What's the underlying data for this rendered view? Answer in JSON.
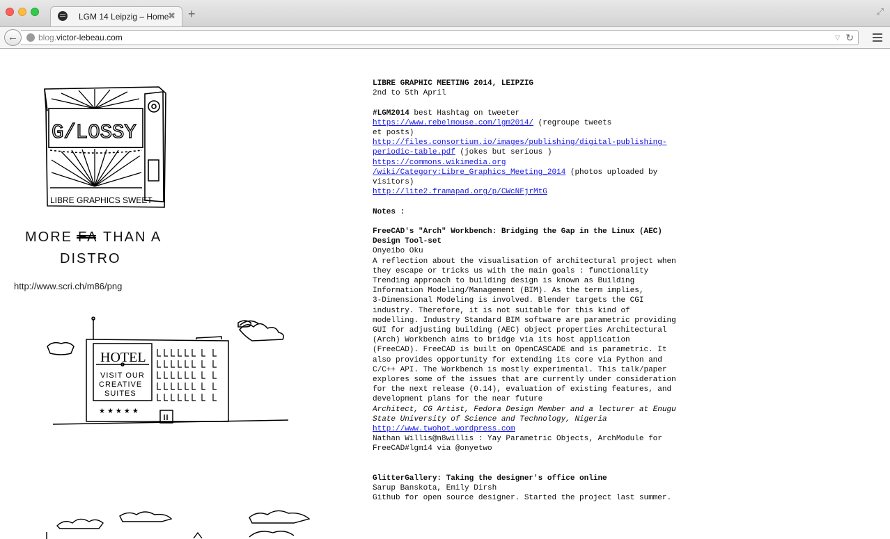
{
  "browser": {
    "tab_title": "LGM 14 Leipzig – Home",
    "tab_close": "✖",
    "new_tab": "+",
    "url_subdomain": "blog.",
    "url_domain": "victor-lebeau.com",
    "back_glyph": "←",
    "reload_glyph": "↻",
    "dropmarker_glyph": "▽",
    "fullscreen_glyph": "⤢"
  },
  "sidebar": {
    "glossy_text": "G/LOSSY",
    "glossy_caption": "LIBRE GRAPHICS SWEET",
    "distro_line1": "MORE",
    "distro_struck": "FA",
    "distro_line1b": "THAN A",
    "distro_line2": "DISTRO",
    "url": "http://www.scri.ch/m86/png",
    "hotel_sign": "HOTEL",
    "hotel_tagline1": "VISIT OUR",
    "hotel_tagline2": "CREATIVE",
    "hotel_tagline3": "SUITES",
    "hotel_stars": "★★★★★"
  },
  "post": {
    "title": "LIBRE GRAPHIC MEETING 2014, LEIPZIG",
    "dates": "2nd to 5th April",
    "hashtag": "#LGM2014",
    "hashtag_text": " best Hashtag on tweeter",
    "link1": "https://www.rebelmouse.com/lgm2014/",
    "link1_note": " (regroupe tweets",
    "link1_note2": "et posts)",
    "link2_a": "http://files.consortium.io/images/publishing/digital-publishing-",
    "link2_b": "periodic-table.pdf",
    "link2_note": " (jokes but serious )",
    "link3_a": "https://commons.wikimedia.org",
    "link3_b": "/wiki/Category:Libre_Graphics_Meeting_2014",
    "link3_note": " (photos uploaded by",
    "link3_note2": "visitors)",
    "link4": "http://lite2.framapad.org/p/CWcNFjrMtG",
    "notes_heading": "Notes :",
    "talk1_title_a": "FreeCAD's \"Arch\" Workbench: Bridging the Gap in the Linux (AEC)",
    "talk1_title_b": "Design Tool-set",
    "talk1_speaker": "Onyeibo Oku",
    "talk1_body": [
      "A reflection about the visualisation of architectural project when",
      "they escape or tricks us with the main goals : functionality",
      "Trending approach to building design is known as Building",
      "Information Modeling/Management (BIM). As the term implies,",
      "3-Dimensional Modeling is involved. Blender targets the CGI",
      "industry. Therefore, it is not suitable for this kind of",
      "modelling. Industry Standard BIM software are parametric providing",
      "GUI for adjusting building (AEC) object properties Architectural",
      "(Arch) Workbench aims to bridge via its host application",
      "(FreeCAD). FreeCAD is built on OpenCASCADE and is parametric. It",
      "also provides opportunity for extending its core via Python and",
      "C/C++ API. The Workbench is mostly experimental. This talk/paper",
      "explores some of the issues that are currently under consideration",
      "for the next release (0.14), evaluation of existing features, and",
      "development plans for the near future"
    ],
    "talk1_bio_a": "Architect, CG Artist, Fedora Design Member and a lecturer at Enugu",
    "talk1_bio_b": "State University of Science and Technology, Nigeria",
    "talk1_link": "http://www.twohot.wordpress.com",
    "talk1_tweet_a": "Nathan Willis@n8willis : Yay Parametric Objects, ArchModule for",
    "talk1_tweet_b": "FreeCAD#lgm14 via @onyetwo",
    "talk2_title": "GlitterGallery: Taking the designer's office online",
    "talk2_speakers": "Sarup Banskota, Emily Dirsh",
    "talk2_body": "Github for open source designer. Started the project last summer."
  }
}
